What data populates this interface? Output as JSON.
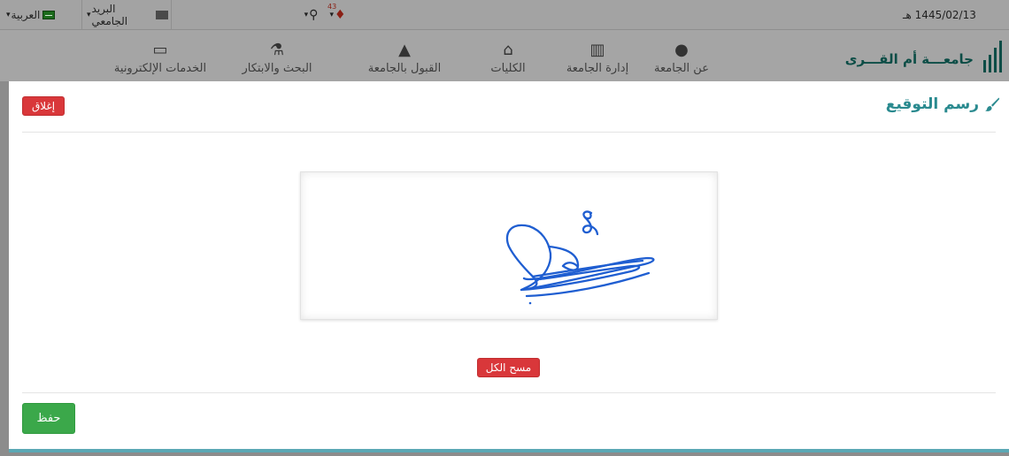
{
  "topbar": {
    "language_label": "العربية",
    "mail_label": "البريد الجامعي",
    "notification_count": "43",
    "date": "1445/02/13 هـ"
  },
  "nav": {
    "university_name": "جامعـــة أم القـــرى",
    "items": [
      {
        "label": "عن الجامعة",
        "icon": "info-icon"
      },
      {
        "label": "إدارة الجامعة",
        "icon": "building-icon"
      },
      {
        "label": "الكليات",
        "icon": "institution-icon"
      },
      {
        "label": "القبول بالجامعة",
        "icon": "graduation-cap-icon"
      },
      {
        "label": "البحث والابتكار",
        "icon": "flask-icon"
      },
      {
        "label": "الخدمات الإلكترونية",
        "icon": "laptop-icon"
      }
    ]
  },
  "modal": {
    "title": "رسم التوقيع",
    "close_label": "إغلاق",
    "clear_label": "مسح الكل",
    "save_label": "حفظ"
  },
  "colors": {
    "title": "#2a8a8f",
    "danger": "#d9373a",
    "success": "#3ba84a",
    "signature_ink": "#1f5ed1",
    "modal_bottom_border": "#5ba8b5"
  }
}
